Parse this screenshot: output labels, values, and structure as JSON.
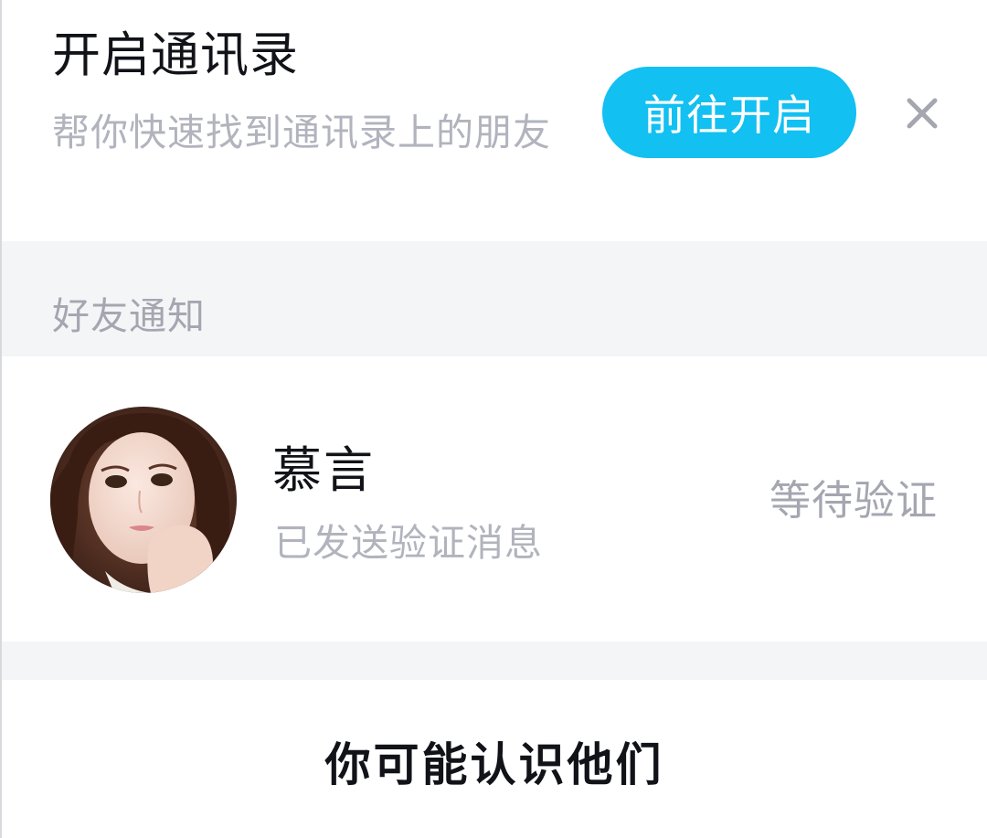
{
  "contacts_banner": {
    "title": "开启通讯录",
    "subtitle": "帮你快速找到通讯录上的朋友",
    "enable_label": "前往开启",
    "close_icon": "close-icon",
    "accent_color": "#12c0f2"
  },
  "friend_notifications": {
    "section_label": "好友通知",
    "items": [
      {
        "name": "慕言",
        "status": "已发送验证消息",
        "state": "等待验证",
        "avatar_icon": "avatar-photo"
      }
    ]
  },
  "suggestions": {
    "title": "你可能认识他们"
  }
}
